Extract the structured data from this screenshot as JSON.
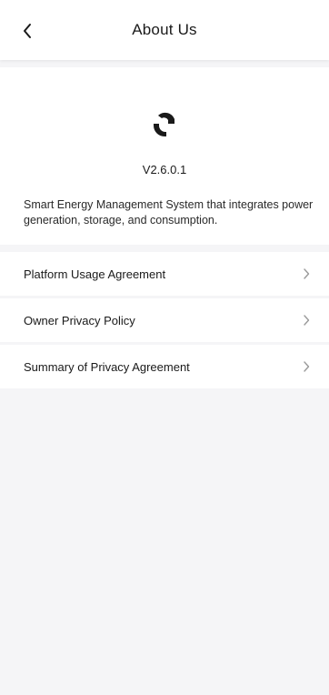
{
  "header": {
    "title": "About Us",
    "back_icon": "chevron-left-icon"
  },
  "about": {
    "logo_icon": "app-logo-icon",
    "version": "V2.6.0.1",
    "description": "Smart Energy Management System that integrates power generation, storage, and consumption."
  },
  "menu": {
    "items": [
      {
        "label": "Platform Usage Agreement",
        "icon": "chevron-right-icon"
      },
      {
        "label": "Owner Privacy Policy",
        "icon": "chevron-right-icon"
      },
      {
        "label": "Summary of Privacy Agreement",
        "icon": "chevron-right-icon"
      }
    ]
  },
  "colors": {
    "background": "#f5f5f7",
    "surface": "#ffffff",
    "text": "#1a1a1a",
    "chevron": "#9a9a9a"
  }
}
